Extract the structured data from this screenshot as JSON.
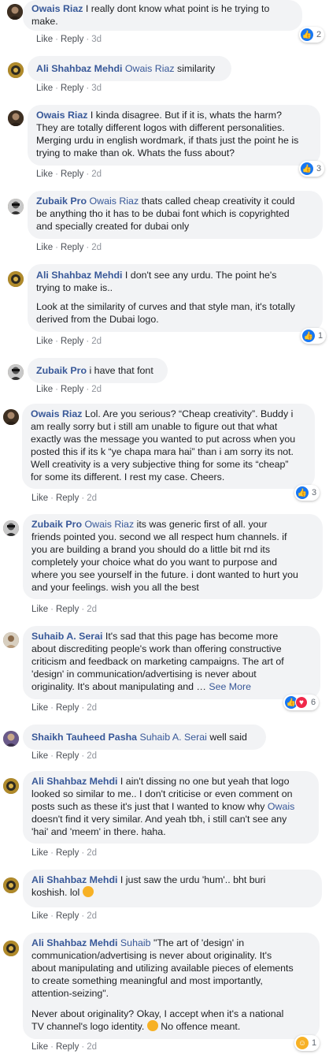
{
  "actions": {
    "like": "Like",
    "reply": "Reply"
  },
  "icons": {
    "like_reaction": "thumbs-up-icon",
    "love_reaction": "heart-icon",
    "haha_reaction": "laughing-face-icon",
    "emoji": "laughing-emoji-icon"
  },
  "colors": {
    "author": "#385898",
    "bubble": "#f2f3f5",
    "like": "#1877f2",
    "love": "#f0284a",
    "haha": "#f7b125"
  },
  "comments": [
    {
      "author": "Owais Riaz",
      "mention": "",
      "lines": [
        "I really dont know what point is he trying to",
        "make."
      ],
      "time": "3d",
      "reactions": "2"
    },
    {
      "author": "Ali Shahbaz Mehdi",
      "mention": "Owais Riaz",
      "lines": [
        "similarity"
      ],
      "time": "3d",
      "reactions": ""
    },
    {
      "author": "Owais Riaz",
      "mention": "",
      "lines": [
        "I kinda disagree. But if it is, whats the harm?",
        "They are totally different logos with different personalities.",
        "Merging urdu in english wordmark, if thats just the point he is",
        "trying to make than ok. Whats the fuss about?"
      ],
      "time": "2d",
      "reactions": "3"
    },
    {
      "author": "Zubaik Pro",
      "mention": "Owais Riaz",
      "lines": [
        "thats called cheap creativity it could",
        "be anything tho it has to be dubai font which is copyrighted",
        "and specially created for dubai only"
      ],
      "time": "2d",
      "reactions": ""
    },
    {
      "author": "Ali Shahbaz Mehdi",
      "mention": "",
      "lines": [
        "I don't see any urdu. The point he's",
        "trying to make is.."
      ],
      "lines2": [
        "Look at the similarity of curves and that style man, it's totally",
        "derived from the Dubai logo."
      ],
      "time": "2d",
      "reactions": "1"
    },
    {
      "author": "Zubaik Pro",
      "mention": "",
      "lines": [
        "i have that font"
      ],
      "time": "2d",
      "reactions": ""
    },
    {
      "author": "Owais Riaz",
      "mention": "",
      "lines": [
        "Lol. Are you serious? “Cheap creativity”. Buddy i",
        "am really sorry but i still am unable to figure out that what",
        "exactly was the message you wanted to put across when you",
        "posted this if its k “ye chapa mara hai” than i am sorry its not.",
        "Well creativity is a very subjective thing for some its “cheap”",
        "for some its different. I rest my case. Cheers."
      ],
      "time": "2d",
      "reactions": "3"
    },
    {
      "author": "Zubaik Pro",
      "mention": "Owais Riaz",
      "lines": [
        "its was generic first of all. your",
        "friends pointed you. second we all respect hum channels. if",
        "you are building a brand you should do a little bit rnd its",
        "completely your choice what do you want to purpose and",
        "where you see yourself in the future. i dont wanted to hurt you",
        "and your feelings. wish you all the best"
      ],
      "time": "2d",
      "reactions": ""
    },
    {
      "author": "Suhaib A. Serai",
      "mention": "",
      "lines": [
        "It's sad that this page has become more",
        "about discrediting people's work than offering constructive",
        "criticism and feedback on marketing campaigns. The art of",
        "'design' in communication/advertising is never about",
        "originality. It's about manipulating and …"
      ],
      "see_more": "See More",
      "time": "2d",
      "reactions": "6"
    },
    {
      "author": "Shaikh Tauheed Pasha",
      "mention": "Suhaib A. Serai",
      "lines": [
        "well said"
      ],
      "time": "2d",
      "reactions": ""
    },
    {
      "author": "Ali Shahbaz Mehdi",
      "mention": "",
      "lines": [
        "I ain't dissing no one but yeah that logo",
        "looked so similar to me.. I don't criticise or even comment on",
        "posts such as these it's just that I wanted to know why",
        "doesn't find it very similar. And yeah tbh, i still can't see any",
        "'hai' and 'meem' in there. haha."
      ],
      "inline_mention": "Owais",
      "time": "2d",
      "reactions": ""
    },
    {
      "author": "Ali Shahbaz Mehdi",
      "mention": "",
      "lines": [
        "I just saw the urdu 'hum'.. bht buri",
        "koshish. lol"
      ],
      "time": "2d",
      "reactions": ""
    },
    {
      "author": "Ali Shahbaz Mehdi",
      "mention": "Suhaib",
      "lines": [
        "\"The art of 'design' in",
        "communication/advertising is never about originality. It's",
        "about manipulating and utilizing available pieces of elements",
        "to create something meaningful and most importantly,",
        "attention-seizing\"."
      ],
      "lines2": [
        "Never about originality? Okay, I accept when it's a national",
        "TV channel's logo identity.",
        "No offence meant."
      ],
      "time": "2d",
      "reactions": "1"
    }
  ]
}
